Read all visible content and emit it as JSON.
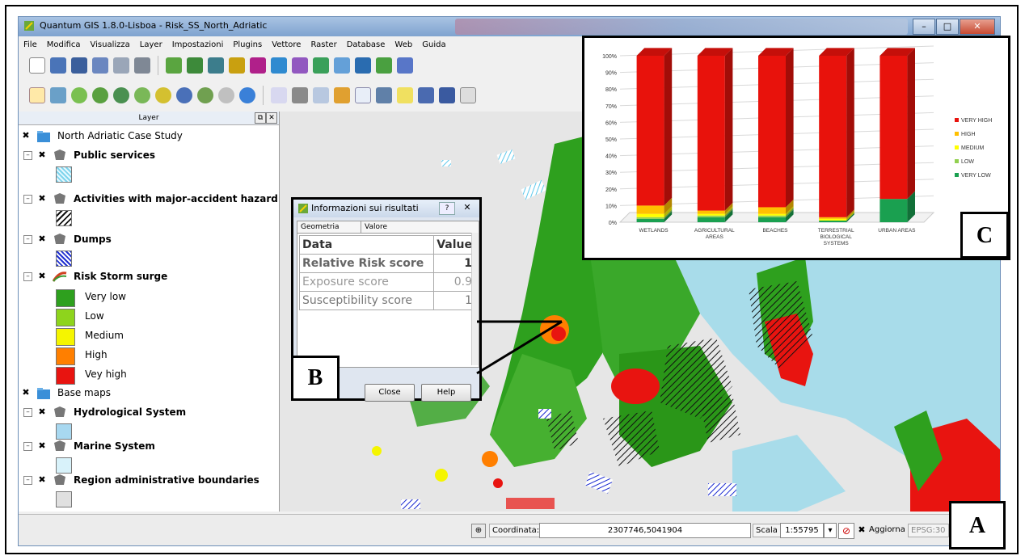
{
  "window": {
    "title": "Quantum GIS 1.8.0-Lisboa - Risk_SS_North_Adriatic"
  },
  "menu": [
    "File",
    "Modifica",
    "Visualizza",
    "Layer",
    "Impostazioni",
    "Plugins",
    "Vettore",
    "Raster",
    "Database",
    "Web",
    "Guida"
  ],
  "layer_panel": {
    "header": "Layer",
    "groups": [
      {
        "label": "North Adriatic Case Study"
      },
      {
        "label": "Base maps"
      }
    ],
    "layers": [
      {
        "label": "Public services"
      },
      {
        "label": "Activities with major-accident hazard"
      },
      {
        "label": "Dumps"
      },
      {
        "label": "Risk Storm surge"
      },
      {
        "label": "Hydrological System"
      },
      {
        "label": "Marine System"
      },
      {
        "label": "Region administrative boundaries"
      }
    ],
    "legend": [
      {
        "label": "Very low",
        "color": "#2ea01e"
      },
      {
        "label": "Low",
        "color": "#8ed41c"
      },
      {
        "label": "Medium",
        "color": "#f5f500"
      },
      {
        "label": "High",
        "color": "#ff7f00"
      },
      {
        "label": "Vey high",
        "color": "#e81410"
      }
    ]
  },
  "status": {
    "coord_label": "Coordinata:",
    "coord_value": "2307746,5041904",
    "scale_label": "Scala",
    "scale_value": "1:55795",
    "refresh": "Aggiorna",
    "epsg": "EPSG:30"
  },
  "dialog": {
    "title": "Informazioni sui risultati",
    "col1": "Geometria",
    "col2": "Valore",
    "rows": [
      {
        "label": "Data",
        "value": "Value"
      },
      {
        "label": "Relative Risk score",
        "value": "1"
      },
      {
        "label": "Exposure score",
        "value": "0.9"
      },
      {
        "label": "Susceptibility score",
        "value": "1"
      }
    ],
    "close": "Close",
    "help": "Help"
  },
  "callouts": {
    "a": "A",
    "b": "B",
    "c": "C"
  },
  "chart_data": {
    "type": "bar",
    "stacked": true,
    "percent": true,
    "categories": [
      "WETLANDS",
      "AGRICULTURAL AREAS",
      "BEACHES",
      "TERRESTRIAL BIOLOGICAL SYSTEMS",
      "URBAN AREAS"
    ],
    "yticks": [
      "0%",
      "10%",
      "20%",
      "30%",
      "40%",
      "50%",
      "60%",
      "70%",
      "80%",
      "90%",
      "100%"
    ],
    "ylim": [
      0,
      100
    ],
    "legend_position": "right",
    "series": [
      {
        "name": "VERY HIGH",
        "color": "#e8120c",
        "values": [
          90,
          93,
          91,
          97,
          86
        ]
      },
      {
        "name": "HIGH",
        "color": "#ffc000",
        "values": [
          5,
          2,
          4,
          1,
          0
        ]
      },
      {
        "name": "MEDIUM",
        "color": "#ffff00",
        "values": [
          2,
          1,
          1,
          1,
          0
        ]
      },
      {
        "name": "LOW",
        "color": "#92d050",
        "values": [
          1,
          1,
          1,
          0,
          0
        ]
      },
      {
        "name": "VERY LOW",
        "color": "#1aa050",
        "values": [
          2,
          3,
          3,
          1,
          14
        ]
      }
    ]
  }
}
